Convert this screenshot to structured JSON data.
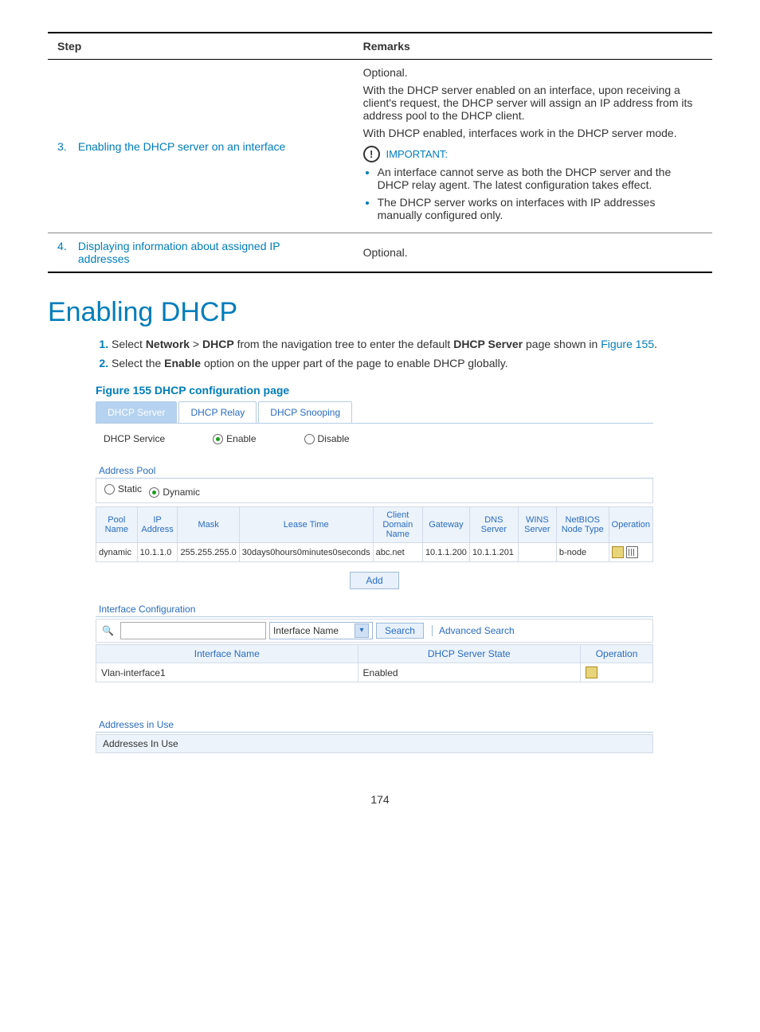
{
  "table": {
    "headers": {
      "step": "Step",
      "remarks": "Remarks"
    },
    "row3": {
      "num": "3.",
      "step": "Enabling the DHCP server on an interface",
      "r1": "Optional.",
      "r2": "With the DHCP server enabled on an interface, upon receiving a client's request, the DHCP server will assign an IP address from its address pool to the DHCP client.",
      "r3": "With DHCP enabled, interfaces work in the DHCP server mode.",
      "imp": "IMPORTANT:",
      "b1": "An interface cannot serve as both the DHCP server and the DHCP relay agent. The latest configuration takes effect.",
      "b2": "The DHCP server works on interfaces with IP addresses manually configured only."
    },
    "row4": {
      "num": "4.",
      "step": "Displaying information about assigned IP addresses",
      "r": "Optional."
    }
  },
  "heading": "Enabling DHCP",
  "steps": {
    "s1a": "Select ",
    "s1_network": "Network",
    "s1_gt": " > ",
    "s1_dhcp": "DHCP",
    "s1b": " from the navigation tree to enter the default ",
    "s1_page": "DHCP Server",
    "s1c": " page shown in ",
    "s1_fig": "Figure 155",
    "s1d": ".",
    "s2a": "Select the ",
    "s2_enable": "Enable",
    "s2b": " option on the upper part of the page to enable DHCP globally."
  },
  "figcap": "Figure 155 DHCP configuration page",
  "shot": {
    "tabs": {
      "t1": "DHCP Server",
      "t2": "DHCP Relay",
      "t3": "DHCP Snooping"
    },
    "svc": {
      "label": "DHCP Service",
      "enable": "Enable",
      "disable": "Disable"
    },
    "pool": {
      "hdr": "Address Pool",
      "static": "Static",
      "dynamic": "Dynamic",
      "th": [
        "Pool Name",
        "IP Address",
        "Mask",
        "Lease Time",
        "Client Domain Name",
        "Gateway",
        "DNS Server",
        "WINS Server",
        "NetBIOS Node Type",
        "Operation"
      ],
      "row": [
        "dynamic",
        "10.1.1.0",
        "255.255.255.0",
        "30days0hours0minutes0seconds",
        "abc.net",
        "10.1.1.200",
        "10.1.1.201",
        "",
        "b-node"
      ]
    },
    "add": "Add",
    "iface": {
      "hdr": "Interface Configuration",
      "sel": "Interface Name",
      "search": "Search",
      "adv": "Advanced Search",
      "th": [
        "Interface Name",
        "DHCP Server State",
        "Operation"
      ],
      "row": [
        "Vlan-interface1",
        "Enabled"
      ]
    },
    "addr": {
      "hdr": "Addresses in Use",
      "box": "Addresses In Use"
    }
  },
  "pagenum": "174"
}
